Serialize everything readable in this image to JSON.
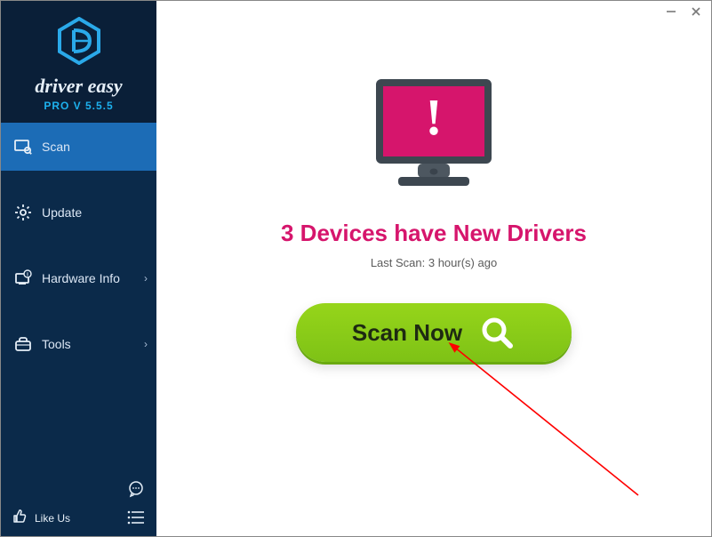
{
  "brand": {
    "name": "driver easy",
    "version_text": "PRO V 5.5.5"
  },
  "nav": {
    "items": [
      {
        "label": "Scan",
        "has_chevron": false
      },
      {
        "label": "Update",
        "has_chevron": false
      },
      {
        "label": "Hardware Info",
        "has_chevron": true
      },
      {
        "label": "Tools",
        "has_chevron": true
      }
    ]
  },
  "footer": {
    "like_label": "Like Us"
  },
  "main": {
    "headline": "3 Devices have New Drivers",
    "subtext": "Last Scan: 3 hour(s) ago",
    "scan_button_label": "Scan Now"
  },
  "colors": {
    "sidebar_bg": "#0b2a4a",
    "sidebar_active": "#1c6cb6",
    "accent_pink": "#d6156c",
    "button_green": "#96d51a",
    "brand_blue": "#1db1ee"
  }
}
